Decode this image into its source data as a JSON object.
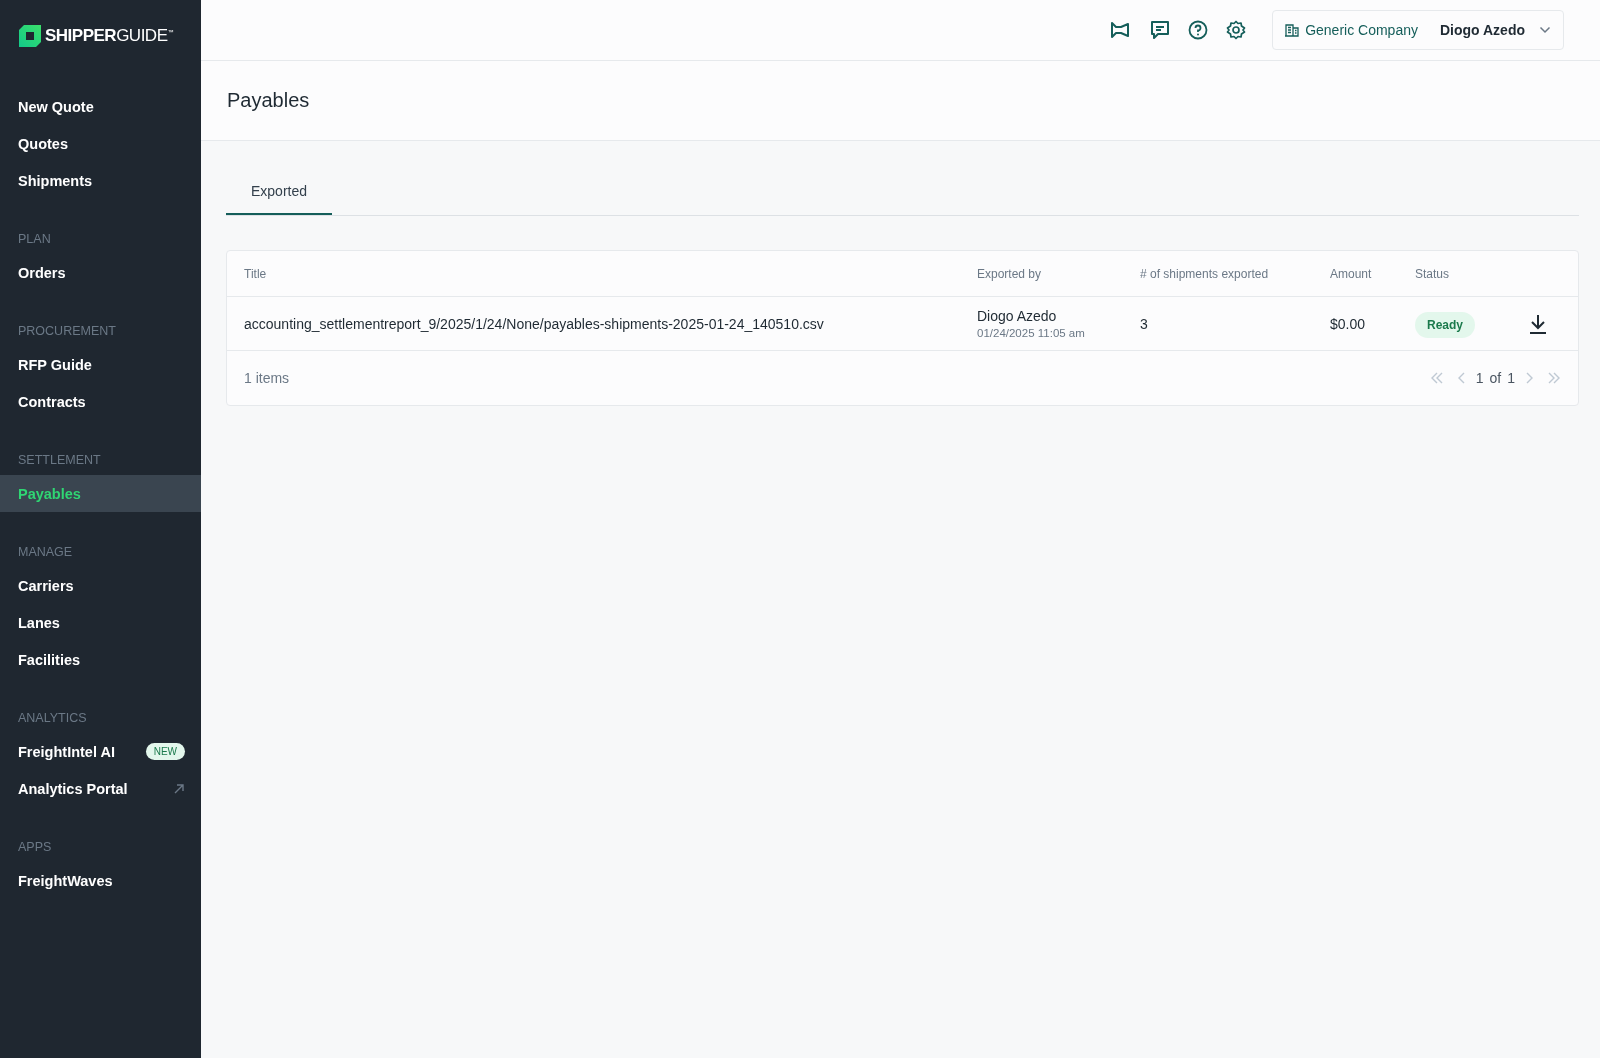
{
  "sidebar": {
    "logo": "**SHIPPER**GUIDE$^{™}$",
    "sections": [
      {
        "items": [
          {
            "label": "New Quote",
            "selected": false
          },
          {
            "label": "Quotes",
            "selected": false
          },
          {
            "label": "Shipments",
            "selected": false
          }
        ]
      },
      {
        "heading": "PLAN",
        "items": [
          {
            "label": "Orders",
            "selected": false
          }
        ]
      },
      {
        "heading": "PROCUREMENT",
        "items": [
          {
            "label": "RFP Guide",
            "selected": false
          },
          {
            "label": "Contracts",
            "selected": false
          }
        ]
      },
      {
        "heading": "SETTLEMENT",
        "items": [
          {
            "label": "Payables",
            "selected": true
          }
        ]
      },
      {
        "heading": "MANAGE",
        "items": [
          {
            "label": "Carriers",
            "selected": false
          },
          {
            "label": "Lanes",
            "selected": false
          },
          {
            "label": "Facilities",
            "selected": false
          }
        ]
      },
      {
        "heading": "ANALYTICS",
        "items": [
          {
            "label": "FreightIntel AI",
            "selected": false,
            "badge": "NEW"
          },
          {
            "label": "Analytics Portal",
            "selected": false,
            "external": true
          }
        ]
      },
      {
        "heading": "APPS",
        "items": [
          {
            "label": "FreightWaves",
            "selected": false
          }
        ]
      }
    ]
  },
  "topbar": {
    "company": "Generic Company",
    "user": "Diogo Azedo"
  },
  "page": {
    "title": "Payables"
  },
  "tabs": [
    {
      "label": "Exported",
      "selected": true
    }
  ],
  "table": {
    "columns": [
      "Title",
      "Exported by",
      "# of shipments exported",
      "Amount",
      "Status"
    ],
    "rows": [
      {
        "title": "accounting_settlementreport_9/2025/1/24/None/payables-shipments-2025-01-24_140510.csv",
        "exported_by": "Diogo Azedo",
        "exported_at": "01/24/2025 11:05 am",
        "shipments": "3",
        "amount": "$0.00",
        "status": "Ready"
      }
    ],
    "count": "1 items",
    "pagination": {
      "page": "1",
      "of": "of",
      "total": "1",
      "first_disabled": true,
      "prev_disabled": true,
      "next_disabled": true,
      "last_disabled": true
    }
  }
}
